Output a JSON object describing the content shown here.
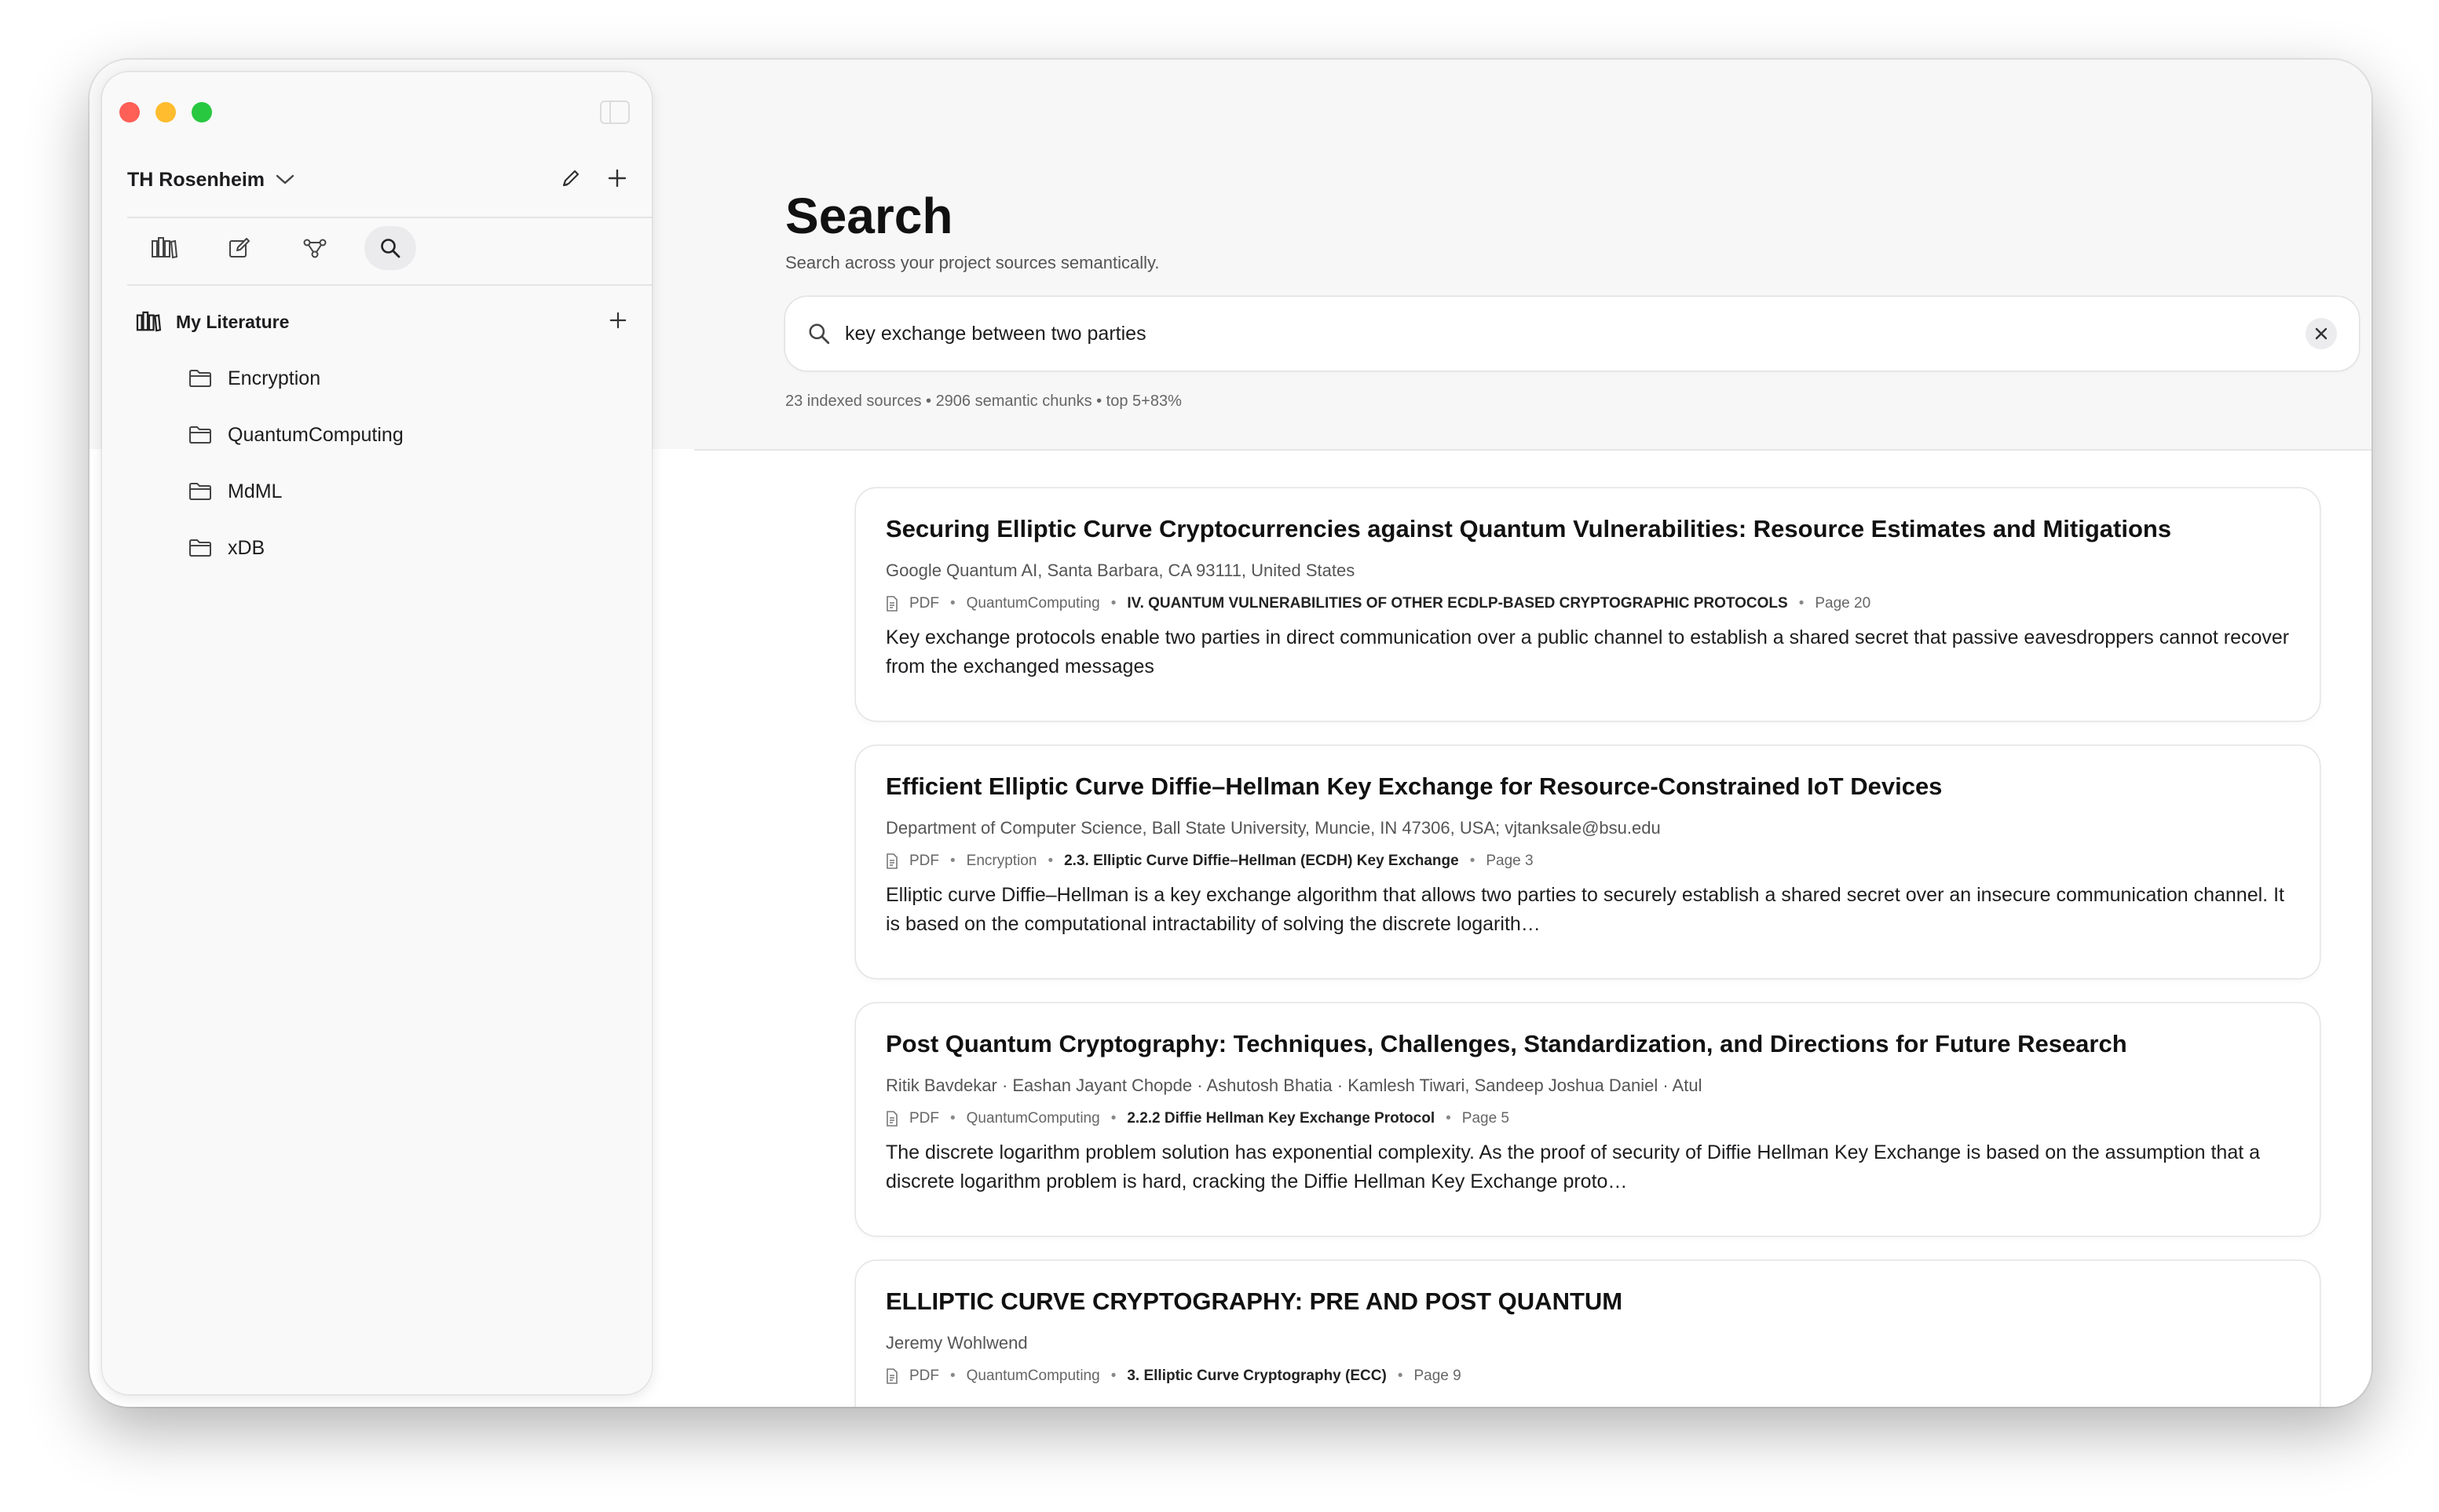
{
  "window": {
    "traffic_lights": [
      "close",
      "minimize",
      "zoom"
    ]
  },
  "sidebar": {
    "workspace_name": "TH Rosenheim",
    "toolbar": [
      {
        "icon": "library-icon",
        "active": false
      },
      {
        "icon": "edit-icon",
        "active": false
      },
      {
        "icon": "graph-icon",
        "active": false
      },
      {
        "icon": "search-icon",
        "active": true
      }
    ],
    "library": {
      "label": "My Literature",
      "folders": [
        "Encryption",
        "QuantumComputing",
        "MdML",
        "xDB"
      ]
    }
  },
  "main": {
    "title": "Search",
    "subtitle": "Search across your project sources semantically.",
    "search": {
      "value": "key exchange between two parties",
      "placeholder": ""
    },
    "stats": "23 indexed sources • 2906 semantic chunks • top 5+83%",
    "results": [
      {
        "title": "Securing Elliptic Curve Cryptocurrencies against Quantum Vulnerabilities: Resource Estimates and Mitigations",
        "authors": "Google Quantum AI, Santa Barbara, CA 93111, United States",
        "type": "PDF",
        "collection": "QuantumComputing",
        "section": "IV. QUANTUM VULNERABILITIES OF OTHER ECDLP-BASED CRYPTOGRAPHIC PROTOCOLS",
        "page": "Page 20",
        "snippet": "Key exchange protocols enable two parties in direct communication over a public channel to establish a shared secret that passive eavesdroppers cannot recover from the exchanged messages"
      },
      {
        "title": "Efficient Elliptic Curve Diffie–Hellman Key Exchange for Resource-Constrained IoT Devices",
        "authors": "Department of Computer Science, Ball State University, Muncie, IN 47306, USA; vjtanksale@bsu.edu",
        "type": "PDF",
        "collection": "Encryption",
        "section": "2.3. Elliptic Curve Diffie–Hellman (ECDH) Key Exchange",
        "page": "Page 3",
        "snippet": "Elliptic curve Diffie–Hellman is a key exchange algorithm that allows two parties to securely establish a shared secret over an insecure communication channel. It is based on the computational intractability of solving the discrete logarith…"
      },
      {
        "title": "Post Quantum Cryptography: Techniques, Challenges, Standardization, and Directions for Future Research",
        "authors": "Ritik Bavdekar · Eashan Jayant Chopde · Ashutosh Bhatia · Kamlesh Tiwari, Sandeep Joshua Daniel · Atul",
        "type": "PDF",
        "collection": "QuantumComputing",
        "section": "2.2.2 Diffie Hellman Key Exchange Protocol",
        "page": "Page 5",
        "snippet": "The discrete logarithm problem solution has exponential complexity. As the proof of security of Diffie Hellman Key Exchange is based on the assumption that a discrete logarithm problem is hard, cracking the Diffie Hellman Key Exchange proto…"
      },
      {
        "title": "ELLIPTIC CURVE CRYPTOGRAPHY: PRE AND POST QUANTUM",
        "authors": "Jeremy Wohlwend",
        "type": "PDF",
        "collection": "QuantumComputing",
        "section": "3. Elliptic Curve Cryptography (ECC)",
        "page": "Page 9",
        "snippet": ""
      }
    ]
  }
}
